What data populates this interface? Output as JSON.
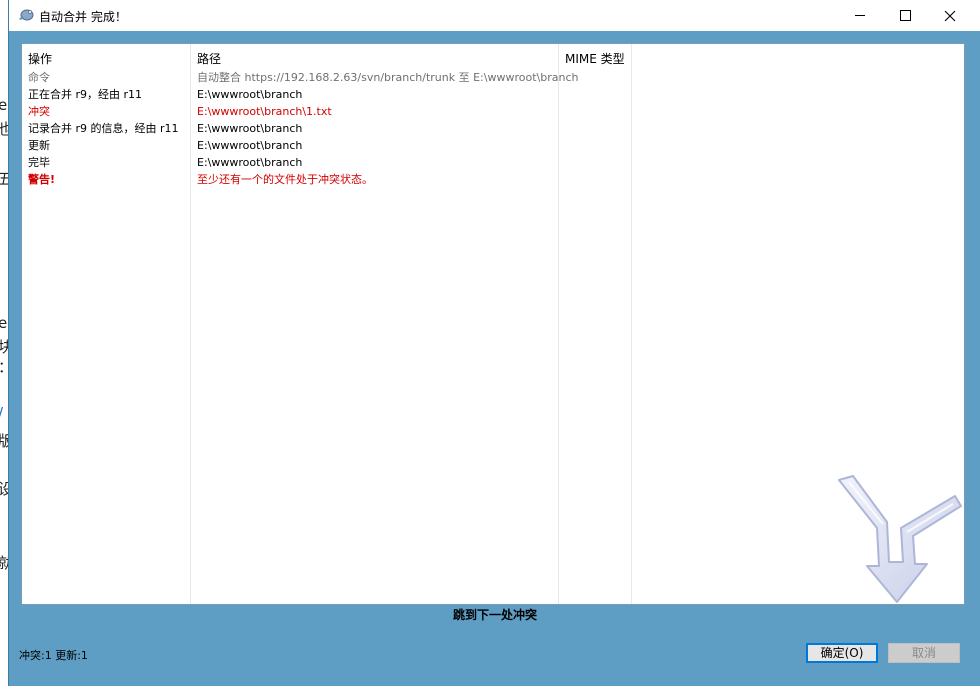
{
  "window": {
    "title": "自动合并 完成！"
  },
  "columns": {
    "operation": "操作",
    "path": "路径",
    "mime": "MIME 类型"
  },
  "rows": [
    {
      "operation": "命令",
      "path": "自动整合 https://192.168.2.63/svn/branch/trunk 至 E:\\wwwroot\\branch",
      "style": "gray"
    },
    {
      "operation": "正在合并 r9，经由 r11",
      "path": "E:\\wwwroot\\branch",
      "style": "black"
    },
    {
      "operation": "冲突",
      "path": "E:\\wwwroot\\branch\\1.txt",
      "style": "red"
    },
    {
      "operation": "记录合并 r9 的信息，经由 r11",
      "path": "E:\\wwwroot\\branch",
      "style": "black"
    },
    {
      "operation": "更新",
      "path": "E:\\wwwroot\\branch",
      "style": "black"
    },
    {
      "operation": "完毕",
      "path": "E:\\wwwroot\\branch",
      "style": "black"
    },
    {
      "operation": "警告!",
      "path": "至少还有一个的文件处于冲突状态。",
      "style": "red-bold"
    }
  ],
  "next_conflict_label": "跳到下一处冲突",
  "status_text": "冲突:1 更新:1",
  "buttons": {
    "ok": "确定(O)",
    "cancel": "取消"
  },
  "colors": {
    "accent": "#0078d7",
    "conflict_red": "#d40000",
    "dialog_bg": "#5f9ec4"
  },
  "icons": {
    "app": "tortoise-svn-icon",
    "watermark": "merge-arrow-icon"
  }
}
